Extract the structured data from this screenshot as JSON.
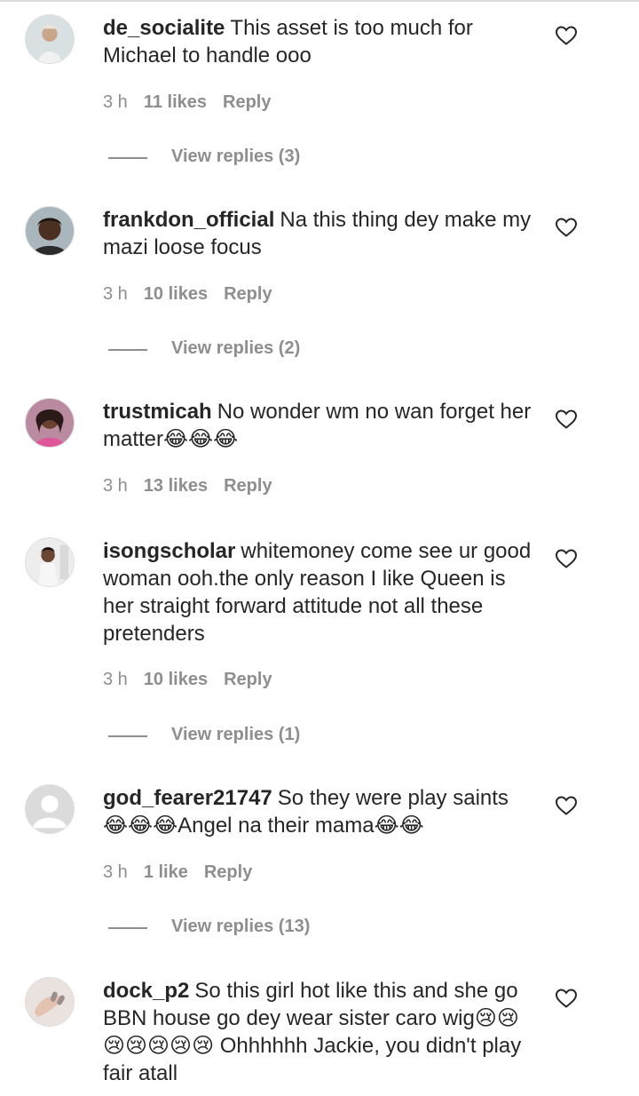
{
  "comments": [
    {
      "username": "de_socialite",
      "text": "This asset is too much for Michael to handle ooo",
      "time": "3 h",
      "likes": "11 likes",
      "reply": "Reply",
      "view_replies": "View replies (3)"
    },
    {
      "username": "frankdon_official",
      "text": "Na this thing dey make my mazi loose focus",
      "time": "3 h",
      "likes": "10 likes",
      "reply": "Reply",
      "view_replies": "View replies (2)"
    },
    {
      "username": "trustmicah",
      "text": "No wonder wm no wan forget her matter😂😂😂",
      "time": "3 h",
      "likes": "13 likes",
      "reply": "Reply"
    },
    {
      "username": "isongscholar",
      "text": "whitemoney come see ur good woman ooh.the only reason I like Queen is her straight forward attitude not all these pretenders",
      "time": "3 h",
      "likes": "10 likes",
      "reply": "Reply",
      "view_replies": "View replies (1)"
    },
    {
      "username": "god_fearer21747",
      "text": "So they were play saints 😂😂😂Angel na their mama😂😂",
      "time": "3 h",
      "likes": "1 like",
      "reply": "Reply",
      "view_replies": "View replies (13)"
    },
    {
      "username": "dock_p2",
      "text": "So this girl hot like this and she go BBN house go dey wear sister caro wig😢😢😢😢😢😢😢 Ohhhhhh Jackie, you didn't play fair atall",
      "time": "",
      "likes": "",
      "reply": ""
    }
  ],
  "icons": {
    "like": "heart-outline-icon",
    "avatar": "user-avatar"
  },
  "colors": {
    "text": "#262626",
    "meta": "#8e8e8e",
    "divider": "#dbdbdb"
  }
}
